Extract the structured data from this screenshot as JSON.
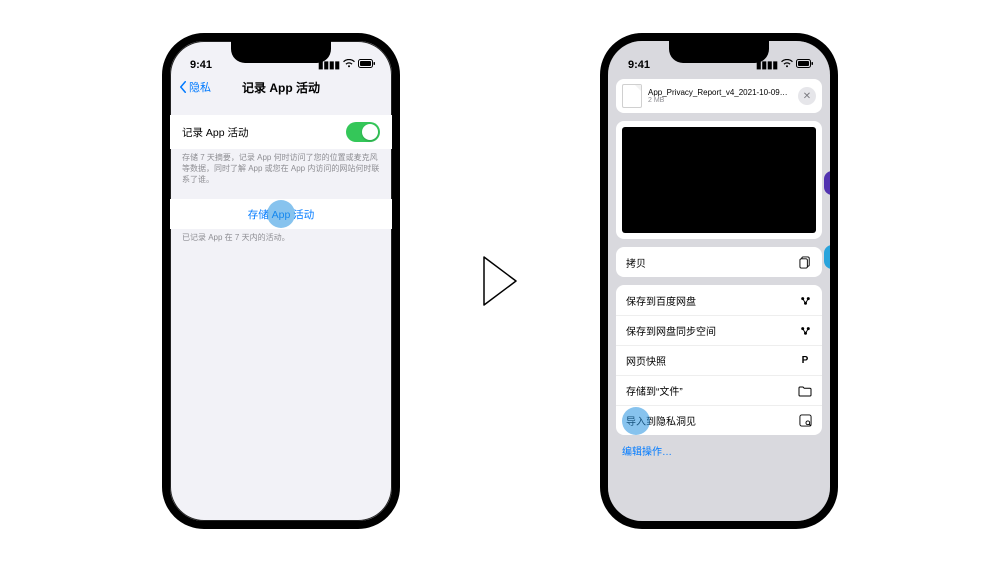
{
  "status": {
    "time": "9:41"
  },
  "left": {
    "back_label": "隐私",
    "title": "记录 App 活动",
    "toggle_label": "记录 App 活动",
    "toggle_on": true,
    "toggle_note": "存储 7 天摘要，记录 App 何时访问了您的位置或麦克风等数据，同时了解 App 或您在 App 内访问的网站何时联系了谁。",
    "save_button": "存储 App 活动",
    "save_note": "已记录 App 在 7 天内的活动。"
  },
  "right": {
    "file_name": "App_Privacy_Report_v4_2021-10-09T10_08...",
    "file_size": "2 MB",
    "actions_group1": [
      {
        "label": "拷贝",
        "icon": "copy-icon"
      }
    ],
    "actions_group2": [
      {
        "label": "保存到百度网盘",
        "icon": "baidu-icon"
      },
      {
        "label": "保存到网盘同步空间",
        "icon": "baidu-icon"
      },
      {
        "label": "网页快照",
        "icon": "pocket-icon"
      },
      {
        "label": "存储到“文件”",
        "icon": "folder-icon"
      },
      {
        "label": "导入到隐私洞见",
        "icon": "privacy-app-icon"
      }
    ],
    "edit_label": "编辑操作…"
  }
}
